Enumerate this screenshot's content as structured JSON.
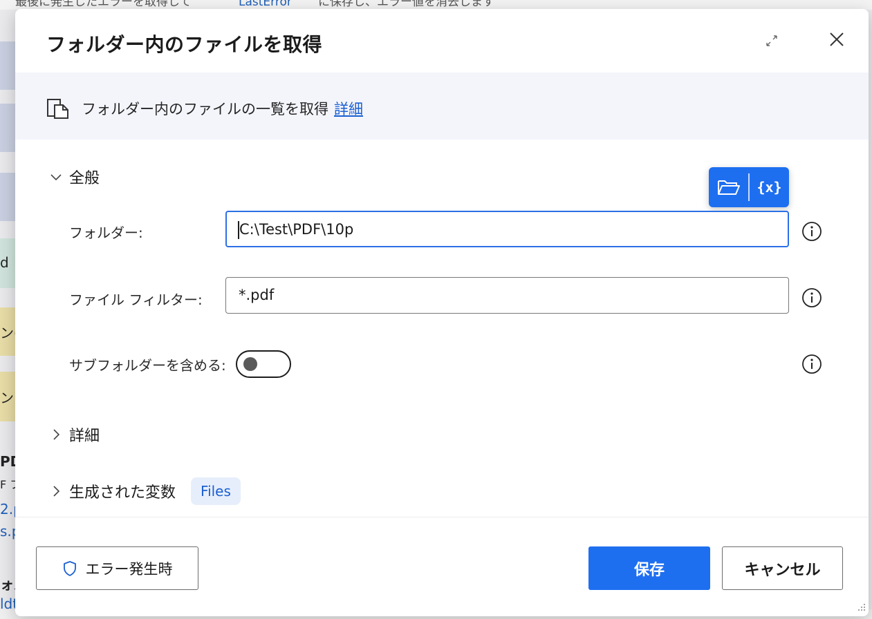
{
  "background": {
    "top_text_left": "最後に発生したエラーを取得して",
    "top_text_link": "LastError",
    "top_text_right": "に保存し、エラー値を消去します",
    "side_fragments": [
      "d",
      "ン(",
      "ン",
      "PDF",
      "F フ",
      "2.p",
      "s.p",
      "ォル",
      "ldt"
    ]
  },
  "dialog": {
    "title": "フォルダー内のファイルを取得",
    "expand_icon": "expand-arrows-icon",
    "close_icon": "close-icon",
    "description": "フォルダー内のファイルの一覧を取得",
    "description_link": "詳細",
    "description_icon": "file-list-icon"
  },
  "sections": {
    "general": "全般",
    "advanced": "詳細",
    "variables": "生成された変数"
  },
  "fields": {
    "folder_label": "フォルダー:",
    "folder_value": "C:\\Test\\PDF\\10p",
    "filter_label": "ファイル フィルター:",
    "filter_value": "*.pdf",
    "subfolder_label": "サブフォルダーを含める:",
    "subfolder_on": false
  },
  "picker": {
    "folder_icon": "folder-open-icon",
    "variable_label": "{x}"
  },
  "variables": [
    "Files"
  ],
  "buttons": {
    "on_error": "エラー発生時",
    "save": "保存",
    "cancel": "キャンセル"
  },
  "colors": {
    "accent": "#1e6ff0",
    "link": "#1a5fd1",
    "band": "#f4f5fb"
  }
}
